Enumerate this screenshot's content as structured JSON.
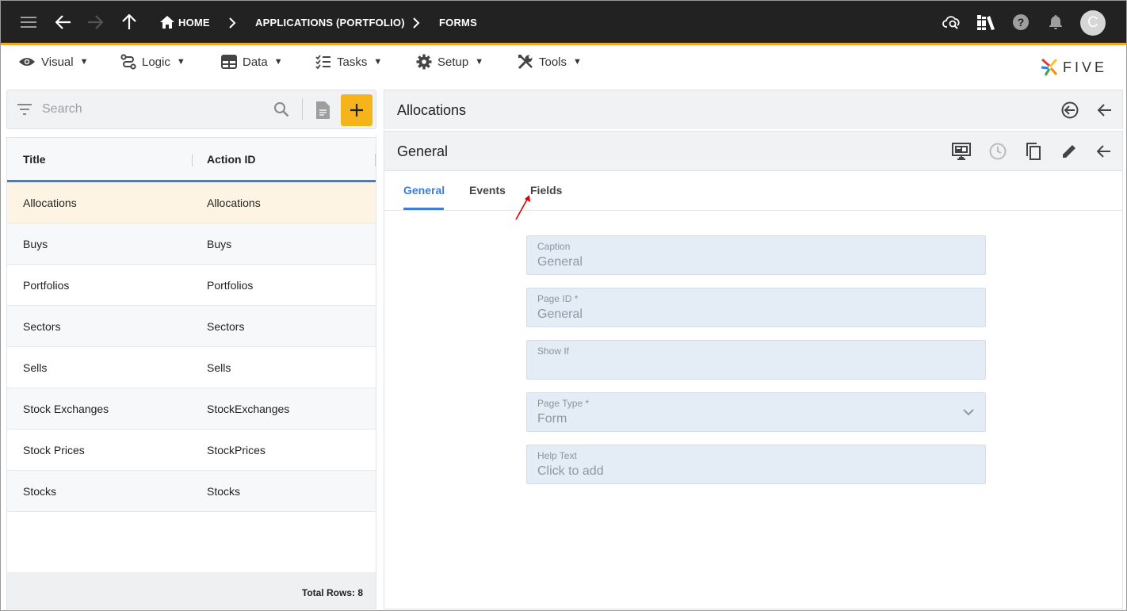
{
  "topbar": {
    "breadcrumbs": [
      "HOME",
      "APPLICATIONS (PORTFOLIO)",
      "FORMS"
    ],
    "avatar_letter": "C"
  },
  "menubar": {
    "items": [
      {
        "label": "Visual",
        "icon": "eye-icon"
      },
      {
        "label": "Logic",
        "icon": "logic-icon"
      },
      {
        "label": "Data",
        "icon": "table-icon"
      },
      {
        "label": "Tasks",
        "icon": "tasks-icon"
      },
      {
        "label": "Setup",
        "icon": "gear-icon"
      },
      {
        "label": "Tools",
        "icon": "tools-icon"
      }
    ],
    "caret": "▼",
    "logo": "FIVE"
  },
  "left": {
    "search_placeholder": "Search",
    "columns": [
      "Title",
      "Action ID"
    ],
    "rows": [
      {
        "title": "Allocations",
        "action_id": "Allocations"
      },
      {
        "title": "Buys",
        "action_id": "Buys"
      },
      {
        "title": "Portfolios",
        "action_id": "Portfolios"
      },
      {
        "title": "Sectors",
        "action_id": "Sectors"
      },
      {
        "title": "Sells",
        "action_id": "Sells"
      },
      {
        "title": "Stock Exchanges",
        "action_id": "StockExchanges"
      },
      {
        "title": "Stock Prices",
        "action_id": "StockPrices"
      },
      {
        "title": "Stocks",
        "action_id": "Stocks"
      }
    ],
    "total_rows": "Total Rows: 8"
  },
  "right": {
    "title": "Allocations",
    "form_title": "General",
    "tabs": [
      "General",
      "Events",
      "Fields"
    ],
    "active_tab": "General",
    "fields": [
      {
        "label": "Caption",
        "value": "General"
      },
      {
        "label": "Page ID *",
        "value": "General"
      },
      {
        "label": "Show If",
        "value": ""
      },
      {
        "label": "Page Type *",
        "value": "Form"
      },
      {
        "label": "Help Text",
        "value": "Click to add"
      }
    ]
  },
  "colors": {
    "topbar": "#222222",
    "accent_orange": "#f5a623",
    "add_button": "#f4b41a",
    "active_tab": "#3b7dd8",
    "selected_row": "#fdf4e3",
    "field_bg": "#e4ecf5",
    "annotation_arrow": "#e00000"
  }
}
